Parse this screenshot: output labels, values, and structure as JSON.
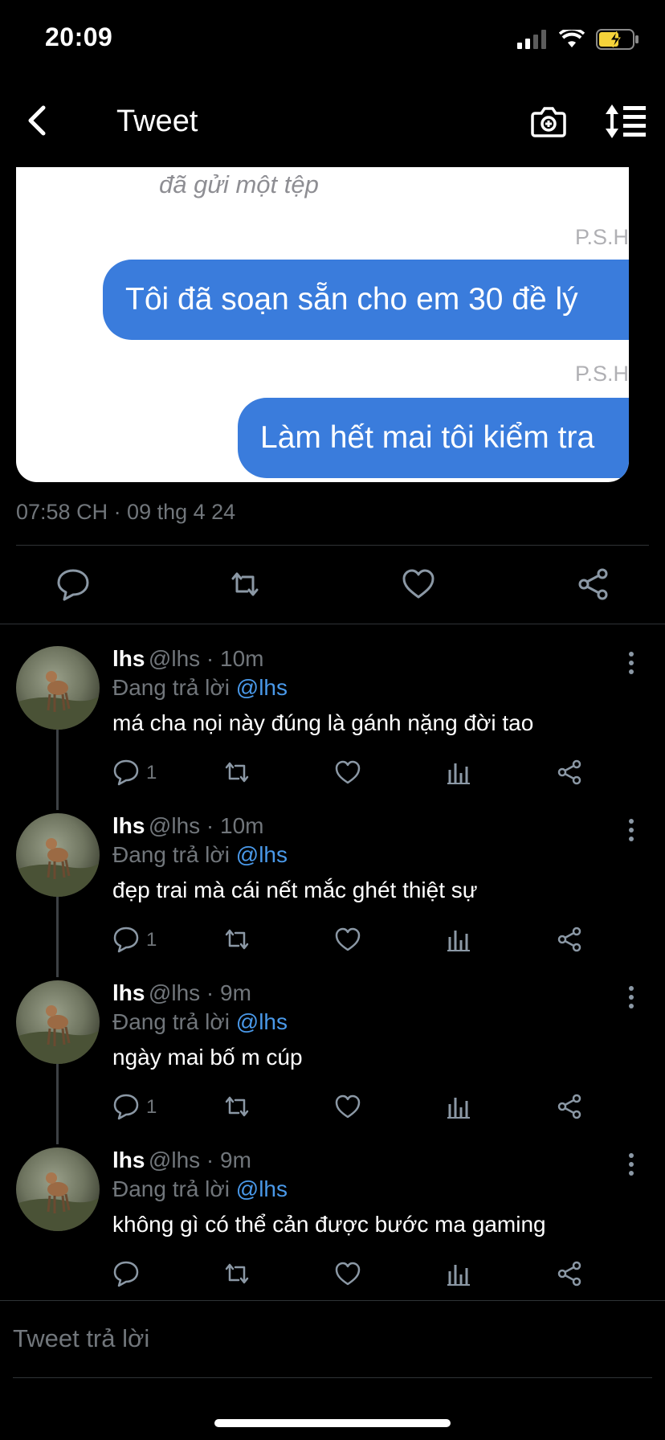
{
  "status_bar": {
    "time": "20:09"
  },
  "nav": {
    "title": "Tweet"
  },
  "media": {
    "sent_file_text": "đã gửi một tệp",
    "sender_initials_1": "P.S.H",
    "bubble_1": "Tôi đã soạn sẵn cho em 30 đề lý",
    "sender_initials_2": "P.S.H",
    "bubble_2": "Làm hết mai tôi kiểm tra"
  },
  "tweet": {
    "timestamp": "07:58 CH · 09 thg 4 24"
  },
  "replies": [
    {
      "name": "lhs",
      "handle": "@lhs · 10m",
      "replying_prefix": "Đang trả lời ",
      "replying_to": "@lhs",
      "text": "má cha nọi này đúng là gánh nặng đời tao",
      "reply_count": "1"
    },
    {
      "name": "lhs",
      "handle": "@lhs · 10m",
      "replying_prefix": "Đang trả lời ",
      "replying_to": "@lhs",
      "text": "đẹp trai mà cái nết mắc ghét thiệt sự",
      "reply_count": "1"
    },
    {
      "name": "lhs",
      "handle": "@lhs · 9m",
      "replying_prefix": "Đang trả lời ",
      "replying_to": "@lhs",
      "text": "ngày mai bố m cúp",
      "reply_count": "1"
    },
    {
      "name": "lhs",
      "handle": "@lhs · 9m",
      "replying_prefix": "Đang trả lời ",
      "replying_to": "@lhs",
      "text": "không gì có thể cản được bước ma gaming",
      "reply_count": ""
    }
  ],
  "composer": {
    "placeholder": "Tweet trả lời"
  },
  "colors": {
    "accent": "#4a99e9",
    "bubble": "#3a7cdc",
    "muted": "#71767b",
    "battery": "#f5d33a"
  },
  "icons": [
    "back-icon",
    "camera-icon",
    "sort-icon",
    "reply-icon",
    "retweet-icon",
    "like-icon",
    "share-icon",
    "views-icon",
    "more-icon"
  ]
}
